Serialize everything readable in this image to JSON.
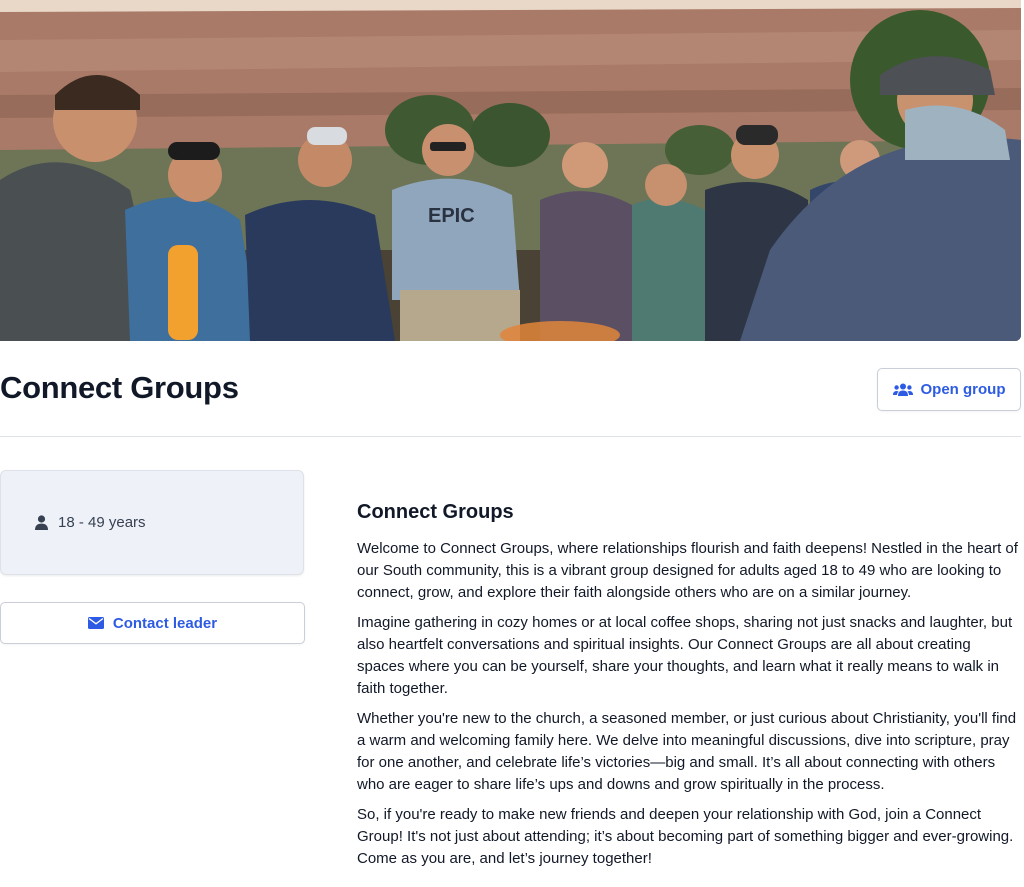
{
  "hero": {
    "image_description": "",
    "shirt_text": "EPIC"
  },
  "header": {
    "title": "Connect Groups",
    "open_group_label": "Open group",
    "open_group_icon": "users-icon"
  },
  "sidebar": {
    "age_icon": "person-icon",
    "age_range": "18 - 49 years",
    "contact_label": "Contact leader",
    "contact_icon": "envelope-icon"
  },
  "main": {
    "heading": "Connect Groups",
    "paragraphs": [
      "Welcome to Connect Groups, where relationships flourish and faith deepens! Nestled in the heart of our South community, this is a vibrant group designed for adults aged 18 to 49 who are looking to connect, grow, and explore their faith alongside others who are on a similar journey.",
      "Imagine gathering in cozy homes or at local coffee shops, sharing not just snacks and laughter, but also heartfelt conversations and spiritual insights. Our Connect Groups are all about creating spaces where you can be yourself, share your thoughts, and learn what it really means to walk in faith together.",
      "Whether you're new to the church, a seasoned member, or just curious about Christianity, you'll find a warm and welcoming family here. We delve into meaningful discussions, dive into scripture, pray for one another, and celebrate life’s victories—big and small. It’s all about connecting with others who are eager to share life’s ups and downs and grow spiritually in the process.",
      "So, if you're ready to make new friends and deepen your relationship with God, join a Connect Group! It's not just about attending; it’s about becoming part of something bigger and ever-growing. Come as you are, and let’s journey together!"
    ]
  },
  "colors": {
    "accent": "#2d5be3",
    "title": "#111827",
    "card_bg": "#eef2f8",
    "divider": "#dfe2e7"
  }
}
